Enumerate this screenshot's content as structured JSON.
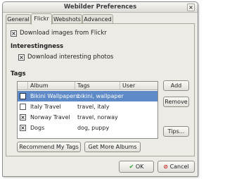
{
  "window": {
    "title": "Webilder Preferences",
    "close_glyph": "×"
  },
  "tabs": [
    {
      "label": "General",
      "active": false
    },
    {
      "label": "Flickr",
      "active": true
    },
    {
      "label": "Webshots",
      "active": false
    },
    {
      "label": "Advanced",
      "active": false
    }
  ],
  "flickr": {
    "download_images_label": "Download images from Flickr",
    "download_images_checked": true,
    "interestingness_heading": "Interestingness",
    "download_interesting_label": "Download interesting photos",
    "download_interesting_checked": true,
    "tags_heading": "Tags"
  },
  "tags_table": {
    "columns": [
      "Album",
      "Tags",
      "User"
    ],
    "rows": [
      {
        "checked": true,
        "album": "Bikini Wallpapers",
        "tags": "bikini, wallpaper",
        "user": "",
        "selected": true
      },
      {
        "checked": false,
        "album": "Italy Travel",
        "tags": "travel, italy",
        "user": "",
        "selected": false
      },
      {
        "checked": true,
        "album": "Norway Travel",
        "tags": "travel, norway",
        "user": "",
        "selected": false
      },
      {
        "checked": true,
        "album": "Dogs",
        "tags": "dog, puppy",
        "user": "",
        "selected": false
      }
    ]
  },
  "buttons": {
    "add": "Add",
    "remove": "Remove",
    "tips": "Tips...",
    "recommend": "Recommend My Tags",
    "more_albums": "Get More Albums",
    "ok": "OK",
    "cancel": "Cancel"
  },
  "colors": {
    "selection": "#5f8ac8",
    "ok_icon": "#2e9b2e",
    "cancel_icon": "#c8281e"
  },
  "icons": {
    "ok": "check-icon",
    "cancel": "cancel-icon",
    "checkbox_mark": "×"
  }
}
